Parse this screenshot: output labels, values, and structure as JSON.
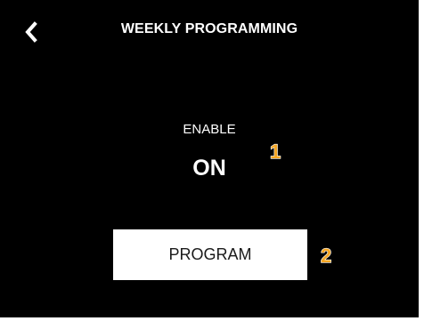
{
  "header": {
    "title": "WEEKLY PROGRAMMING",
    "back_icon": "chevron-left-icon"
  },
  "enable": {
    "label": "ENABLE",
    "value": "ON"
  },
  "program_button": {
    "label": "PROGRAM"
  },
  "callouts": [
    "1",
    "2"
  ],
  "colors": {
    "background": "#000000",
    "text": "#ffffff",
    "button_bg": "#ffffff",
    "button_text": "#1a1a1a",
    "callout": "#f5a623"
  }
}
